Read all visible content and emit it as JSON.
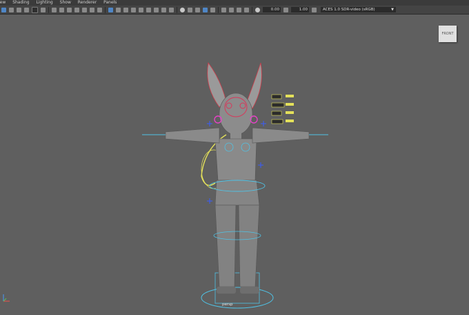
{
  "menubar": {
    "items": [
      "iew",
      "Shading",
      "Lighting",
      "Show",
      "Renderer",
      "Panels"
    ]
  },
  "toolbar": {
    "exposure_value": "0.00",
    "gamma_value": "1.00",
    "color_space": "ACES 1.0 SDR-video (sRGB)"
  },
  "viewport": {
    "viewcube_label": "FRONT",
    "camera_label": "persp"
  },
  "colors": {
    "background": "#5f5f5f",
    "rig_controls": "#4fc3e6",
    "ik_controls": "#e3e05a",
    "face_controls": "#d9365a",
    "mesh": "#8a8a8a"
  }
}
